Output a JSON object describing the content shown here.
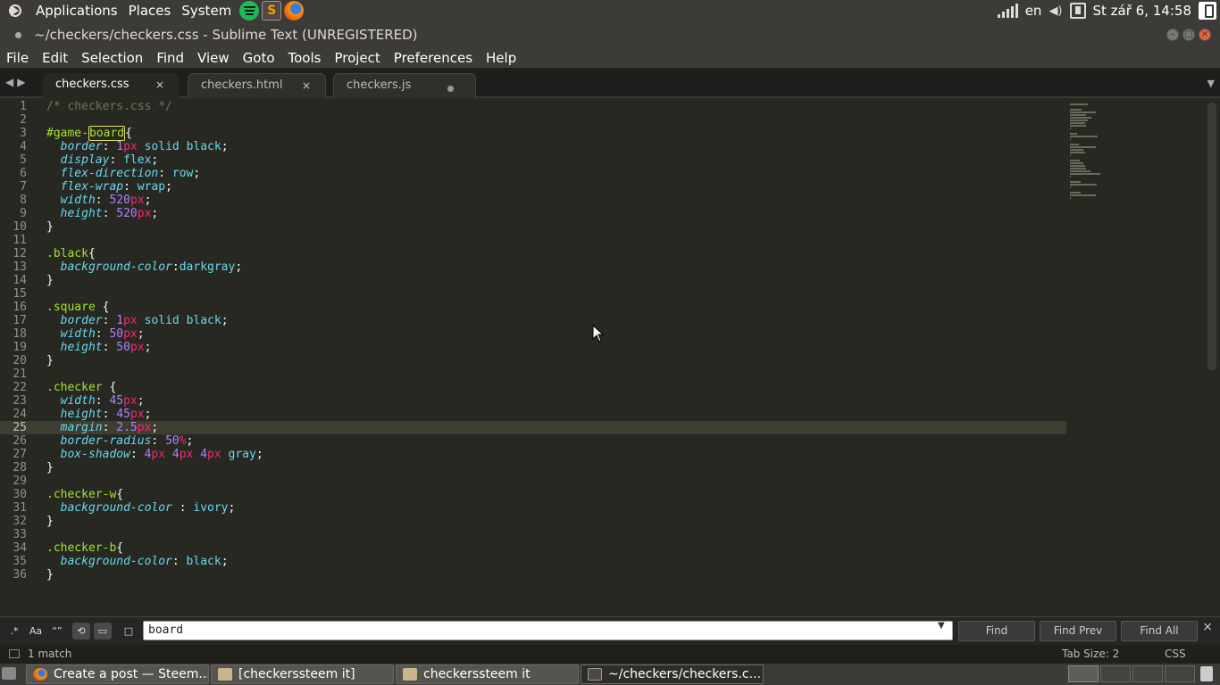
{
  "topbar": {
    "menus": [
      "Applications",
      "Places",
      "System"
    ],
    "keyboard": "en",
    "clock": "St zář 6, 14:58"
  },
  "window": {
    "title": "~/checkers/checkers.css - Sublime Text (UNREGISTERED)",
    "menu": [
      "File",
      "Edit",
      "Selection",
      "Find",
      "View",
      "Goto",
      "Tools",
      "Project",
      "Preferences",
      "Help"
    ]
  },
  "tabs": [
    {
      "label": "checkers.css",
      "state": "active",
      "close": "×"
    },
    {
      "label": "checkers.html",
      "state": "inactive",
      "close": "×"
    },
    {
      "label": "checkers.js",
      "state": "modified"
    }
  ],
  "editor": {
    "current_line": 25,
    "lines": [
      "/* checkers.css */",
      "",
      "#game-board{",
      "  border: 1px solid black;",
      "  display: flex;",
      "  flex-direction: row;",
      "  flex-wrap: wrap;",
      "  width: 520px;",
      "  height: 520px;",
      "}",
      "",
      ".black{",
      "  background-color:darkgray;",
      "}",
      "",
      ".square {",
      "  border: 1px solid black;",
      "  width: 50px;",
      "  height: 50px;",
      "}",
      "",
      ".checker {",
      "  width: 45px;",
      "  height: 45px;",
      "  margin: 2.5px;",
      "  border-radius: 50%;",
      "  box-shadow: 4px 4px 4px gray;",
      "}",
      "",
      ".checker-w{",
      "  background-color : ivory;",
      "}",
      "",
      ".checker-b{",
      "  background-color: black;",
      "}"
    ]
  },
  "find": {
    "toggles": [
      ".*",
      "Aa",
      "“”"
    ],
    "query": "board",
    "buttons": [
      "Find",
      "Find Prev",
      "Find All"
    ]
  },
  "status": {
    "matches": "1 match",
    "tab_size": "Tab Size: 2",
    "syntax": "CSS"
  },
  "taskbar": [
    {
      "label": "Create a post — Steem...",
      "icon": "firefox-icon"
    },
    {
      "label": "[checkerssteem it]",
      "icon": "folder-icon"
    },
    {
      "label": "checkerssteem it",
      "icon": "folder-icon"
    },
    {
      "label": "~/checkers/checkers.c...",
      "icon": "sublime-icon"
    }
  ],
  "colors": {
    "editor_bg": "#272822",
    "comment": "#75715e",
    "selector": "#a6e22e",
    "property": "#66d9ef",
    "number": "#ae81ff",
    "unit": "#f92672",
    "panel_bg": "#3c3b37"
  }
}
